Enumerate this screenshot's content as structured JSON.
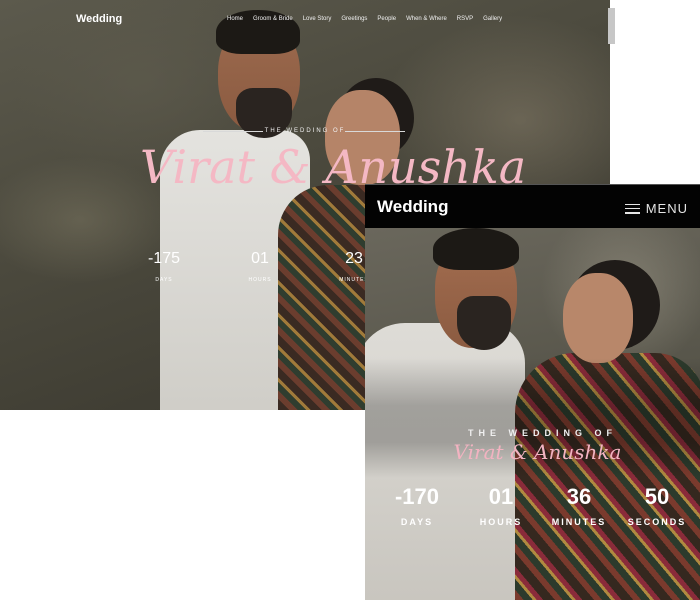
{
  "desktop": {
    "logo": "Wedding",
    "nav": [
      "Home",
      "Groom & Bride",
      "Love Story",
      "Greetings",
      "People",
      "When & Where",
      "RSVP",
      "Gallery"
    ],
    "wedding_of": "THE WEDDING OF",
    "names": "Virat & Anushka",
    "countdown": [
      {
        "value": "-175",
        "label": "DAYS"
      },
      {
        "value": "01",
        "label": "HOURS"
      },
      {
        "value": "23",
        "label": "MINUTES"
      }
    ]
  },
  "mobile": {
    "logo": "Wedding",
    "menu_label": "MENU",
    "wedding_of": "THE WEDDING OF",
    "names": "Virat & Anushka",
    "countdown": [
      {
        "value": "-170",
        "label": "DAYS"
      },
      {
        "value": "01",
        "label": "HOURS"
      },
      {
        "value": "36",
        "label": "MINUTES"
      },
      {
        "value": "50",
        "label": "SECONDS"
      }
    ]
  },
  "colors": {
    "name_script": "#f4b8c4",
    "header_bg": "#030303"
  }
}
